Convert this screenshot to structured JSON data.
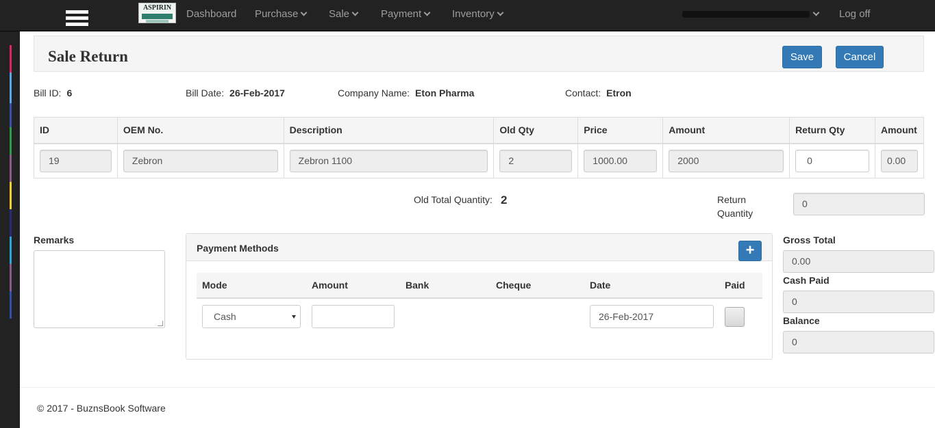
{
  "nav": {
    "logo_text": "ASPIRIN",
    "items": [
      {
        "label": "Dashboard",
        "has_dropdown": false
      },
      {
        "label": "Purchase",
        "has_dropdown": true
      },
      {
        "label": "Sale",
        "has_dropdown": true
      },
      {
        "label": "Payment",
        "has_dropdown": true
      },
      {
        "label": "Inventory",
        "has_dropdown": true
      }
    ],
    "logoff": "Log off"
  },
  "page": {
    "title": "Sale Return",
    "save_label": "Save",
    "cancel_label": "Cancel"
  },
  "info": {
    "bill_id_label": "Bill ID:",
    "bill_id": "6",
    "bill_date_label": "Bill Date:",
    "bill_date": "26-Feb-2017",
    "company_label": "Company Name:",
    "company": "Eton Pharma",
    "contact_label": "Contact:",
    "contact": "Etron"
  },
  "items_table": {
    "headers": [
      "ID",
      "OEM No.",
      "Description",
      "Old Qty",
      "Price",
      "Amount",
      "Return Qty",
      "Amount"
    ],
    "rows": [
      {
        "id": "19",
        "oem": "Zebron",
        "description": "Zebron 1100",
        "old_qty": "2",
        "price": "1000.00",
        "amount": "2000",
        "return_qty": "0",
        "return_amount": "0.00"
      }
    ]
  },
  "totals": {
    "old_total_label": "Old Total Quantity:",
    "old_total": "2",
    "return_qty_label": "Return Quantity",
    "return_qty": "0"
  },
  "remarks": {
    "label": "Remarks"
  },
  "payment": {
    "title": "Payment Methods",
    "add_label": "+",
    "headers": [
      "Mode",
      "Amount",
      "Bank",
      "Cheque",
      "Date",
      "Paid"
    ],
    "rows": [
      {
        "mode": "Cash",
        "amount": "",
        "bank": "",
        "cheque": "",
        "date": "26-Feb-2017",
        "paid": false
      }
    ]
  },
  "summary": {
    "gross_label": "Gross Total",
    "gross": "0.00",
    "cash_label": "Cash Paid",
    "cash": "0",
    "balance_label": "Balance",
    "balance": "0"
  },
  "footer": {
    "text": "© 2017 - BuznsBook Software"
  },
  "colors": {
    "navbar": "#222222",
    "primary_button": "#337ab7",
    "rail_accents": [
      "#e0245e",
      "#5aa9e6",
      "#3a4fb0",
      "#2e9e44",
      "#8e5a8a",
      "#f2d027",
      "#2a2a7a",
      "#29a8d8",
      "#8a5a8a",
      "#3050b0"
    ]
  }
}
